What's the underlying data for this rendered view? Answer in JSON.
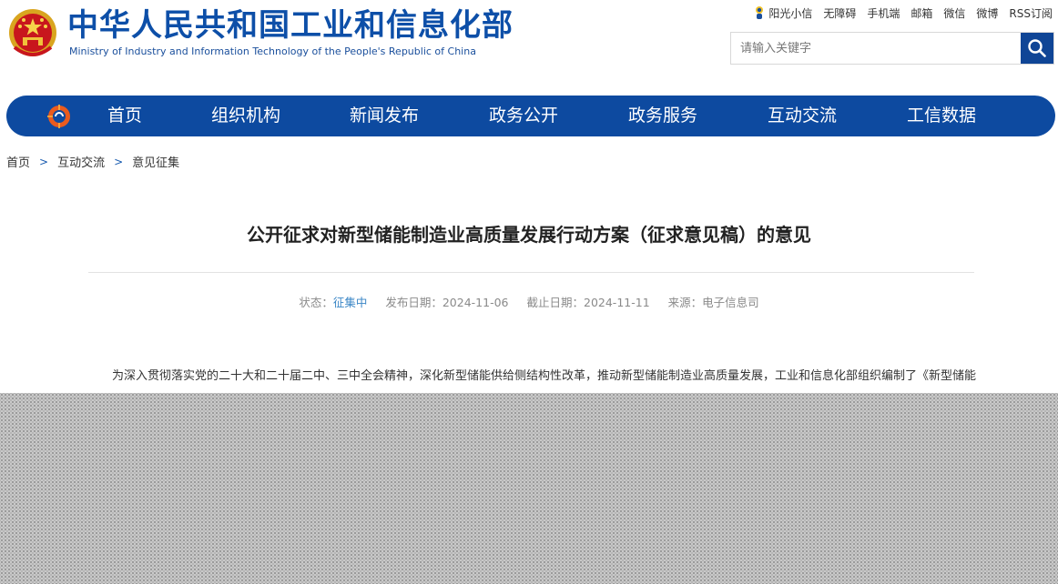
{
  "header": {
    "title": "中华人民共和国工业和信息化部",
    "subtitle": "Ministry of Industry and Information Technology of the People's Republic of China",
    "top_links": [
      "阳光小信",
      "无障碍",
      "手机端",
      "邮箱",
      "微信",
      "微博",
      "RSS订阅"
    ],
    "search": {
      "placeholder": "请输入关键字",
      "value": ""
    }
  },
  "nav": {
    "items": [
      "首页",
      "组织机构",
      "新闻发布",
      "政务公开",
      "政务服务",
      "互动交流",
      "工信数据"
    ]
  },
  "breadcrumb": {
    "items": [
      "首页",
      "互动交流",
      "意见征集"
    ],
    "separator": ">"
  },
  "article": {
    "title": "公开征求对新型储能制造业高质量发展行动方案（征求意见稿）的意见",
    "meta": {
      "status_label": "状态：",
      "status_value": "征集中",
      "publish_label": "发布日期：",
      "publish_date": "2024-11-06",
      "deadline_label": "截止日期：",
      "deadline_date": "2024-11-11",
      "source_label": "来源：",
      "source_value": "电子信息司"
    },
    "body": "为深入贯彻落实党的二十大和二十届二中、三中全会精神，深化新型储能供给侧结构性改革，推动新型储能制造业高质量发展，工业和信息化部组织编制了《新型储能制造业高质量发展行动方案》（征求意见稿），现公开征求意见。如有意见或建议，请于2024年11月11日前书面反馈至"
  },
  "colors": {
    "brand_blue": "#0d4aa0",
    "title_blue": "#0d4fa8",
    "status_blue": "#3a86c6"
  }
}
